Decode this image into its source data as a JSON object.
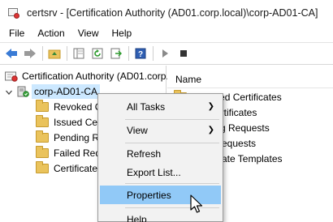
{
  "window": {
    "title": "certsrv - [Certification Authority (AD01.corp.local)\\corp-AD01-CA]"
  },
  "menubar": {
    "items": [
      "File",
      "Action",
      "View",
      "Help"
    ]
  },
  "toolbar": {
    "buttons": [
      "back-icon",
      "forward-icon",
      "up-folder-icon",
      "show-hide-tree-icon",
      "refresh-icon",
      "export-icon",
      "help-icon",
      "start-service-icon",
      "stop-service-icon"
    ]
  },
  "tree": {
    "root": "Certification Authority (AD01.corp.local)",
    "ca": "corp-AD01-CA",
    "children": [
      "Revoked Certificates",
      "Issued Certificates",
      "Pending Requests",
      "Failed Requests",
      "Certificate Templates"
    ],
    "children_visible": [
      "Revoked C",
      "Issued Certi",
      "Pending Re",
      "Failed Requ",
      "Certificate"
    ]
  },
  "list": {
    "column_header": "Name",
    "rows_visible": [
      "Revoked Certificates",
      "ertificates",
      "g Requests",
      "equests",
      "ate Templates"
    ]
  },
  "context_menu": {
    "all_tasks": "All Tasks",
    "view": "View",
    "refresh": "Refresh",
    "export_list": "Export List...",
    "properties": "Properties",
    "help": "Help",
    "highlighted": "Properties"
  },
  "colors": {
    "selection": "#cce8ff",
    "menu_highlight": "#91c9f7",
    "folder": "#eac35c"
  }
}
